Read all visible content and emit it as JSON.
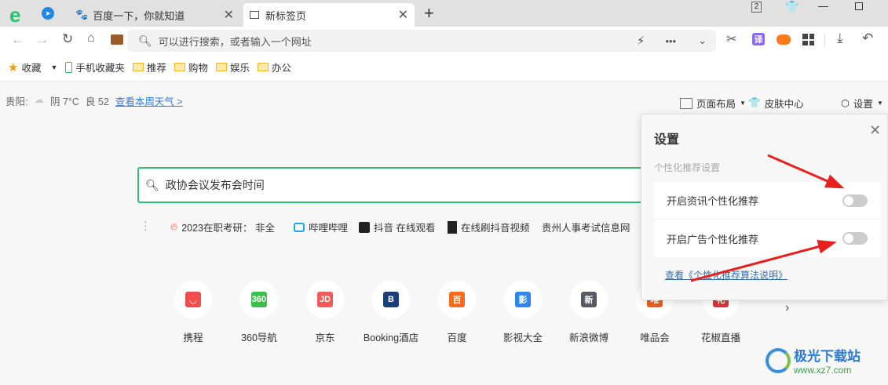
{
  "tabs": [
    {
      "label": "百度一下，你就知道",
      "active": false
    },
    {
      "label": "新标签页",
      "active": true
    }
  ],
  "window": {
    "tab_count": "2"
  },
  "address": {
    "placeholder": "可以进行搜索，或者输入一个网址"
  },
  "toolbar_icons": [
    "back-icon",
    "forward-icon",
    "refresh-icon",
    "home-icon",
    "briefcase-icon",
    "lightning-icon",
    "more-icon",
    "chevron-down-icon",
    "scissors-icon",
    "translate-icon",
    "game-icon",
    "apps-icon",
    "download-icon",
    "undo-icon"
  ],
  "translate_glyph": "译",
  "bookmarks": {
    "favorites": "收藏",
    "items": [
      "手机收藏夹",
      "推荐",
      "购物",
      "娱乐",
      "办公"
    ]
  },
  "weather": {
    "city": "贵阳:",
    "condition": "阴 7°C",
    "air": "良 52",
    "link": "查看本周天气 >"
  },
  "page_tools": {
    "layout": "页面布局",
    "skin": "皮肤中心",
    "settings": "设置"
  },
  "search": {
    "value": "政协会议发布会时间"
  },
  "hot": [
    "2023在职考研：  非全",
    "哔哩哔哩",
    "抖音 在线观看",
    "在线刷抖音视频",
    "贵州人事考试信息网"
  ],
  "sites": [
    {
      "label": "携程",
      "glyph": "◡",
      "color": "#f24c4c"
    },
    {
      "label": "360导航",
      "glyph": "360",
      "color": "#3cbf4a"
    },
    {
      "label": "京东",
      "glyph": "JD",
      "color": "#f25a5a"
    },
    {
      "label": "Booking酒店",
      "glyph": "B",
      "color": "#1a3e7a"
    },
    {
      "label": "百度",
      "glyph": "百",
      "color": "#ff6a1a"
    },
    {
      "label": "影视大全",
      "glyph": "影",
      "color": "#2e86f2"
    },
    {
      "label": "新浪微博",
      "glyph": "新",
      "color": "#5a5a66"
    },
    {
      "label": "唯品会",
      "glyph": "唯",
      "color": "#e8601c"
    },
    {
      "label": "花椒直播",
      "glyph": "花",
      "color": "#d9363e"
    }
  ],
  "settings_panel": {
    "title": "设置",
    "section": "个性化推荐设置",
    "options": [
      {
        "label": "开启资讯个性化推荐",
        "on": false
      },
      {
        "label": "开启广告个性化推荐",
        "on": false
      }
    ],
    "link": "查看《个性化推荐算法说明》"
  },
  "watermark": {
    "name": "极光下载站",
    "url": "www.xz7.com"
  },
  "colors": {
    "accent": "#2fbf71",
    "link": "#3a7bd5",
    "arrow": "#e8201c"
  }
}
